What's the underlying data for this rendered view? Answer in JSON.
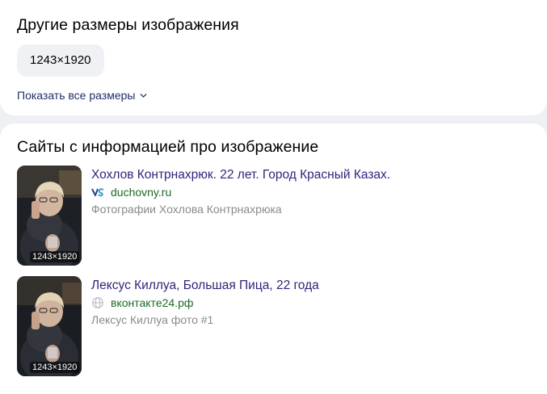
{
  "sizes_section": {
    "title": "Другие размеры изображения",
    "sizes": [
      "1243×1920"
    ],
    "show_all_label": "Показать все размеры"
  },
  "sites_section": {
    "title": "Сайты с информацией про изображение",
    "items": [
      {
        "title": "Хохлов Контрнахрюк. 22 лет. Город Красный Казах.",
        "domain": "duchovny.ru",
        "favicon": "vs-logo-icon",
        "description": "Фотографии Хохлова Контрнахрюка",
        "thumb_size": "1243×1920"
      },
      {
        "title": "Лексус Киллуа, Большая Пица, 22 года",
        "domain": "вконтакте24.рф",
        "favicon": "globe-icon",
        "description": "Лексус Киллуа фото #1",
        "thumb_size": "1243×1920"
      }
    ]
  },
  "colors": {
    "link_title": "#31237b",
    "link_secondary": "#202d6b",
    "domain": "#1a6b24",
    "muted": "#8a8a8a",
    "chip_bg": "#f0f1f4",
    "page_bg": "#eef0f3"
  }
}
